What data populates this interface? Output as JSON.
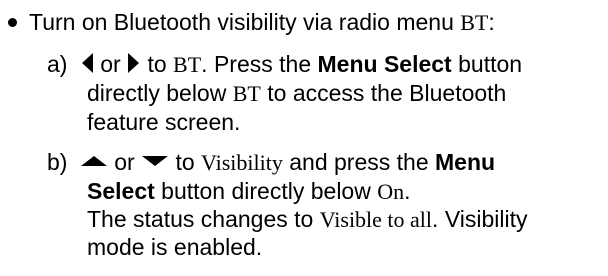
{
  "bullet": {
    "text_before": "Turn on Bluetooth visibility via radio menu ",
    "menu_name": "BT",
    "text_after": ":"
  },
  "step_a": {
    "marker": "a)",
    "or": " or ",
    "to": " to ",
    "menu": "BT",
    "press": ". Press the ",
    "button": "Menu Select",
    "button_rest": " button",
    "line2_text": "directly below ",
    "line2_menu": "BT",
    "line2_rest": " to access the Bluetooth",
    "line3": "feature screen.",
    "icons": [
      "left-arrow-icon",
      "right-arrow-icon"
    ]
  },
  "step_b": {
    "marker": "b)",
    "or": " or ",
    "to": " to ",
    "item": "Visibility",
    "press": " and press the ",
    "button_part1": "Menu",
    "button_part2": "Select",
    "line2_rest": " button directly below ",
    "line2_option": "On",
    "line2_end": ".",
    "status_text": "The status changes to ",
    "status_value": "Visible to all",
    "status_rest": ". Visibility",
    "line4": "mode is enabled.",
    "icons": [
      "up-arrow-icon",
      "down-arrow-icon"
    ]
  }
}
